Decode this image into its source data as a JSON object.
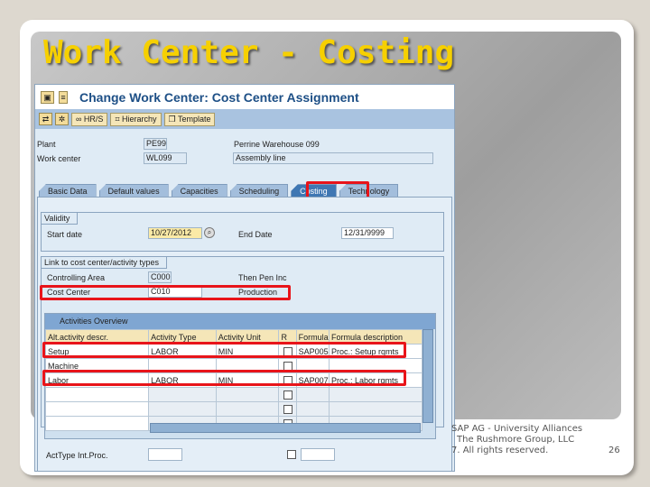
{
  "slide": {
    "title": "Work Center - Costing",
    "footer": [
      "SAP AG - University Alliances",
      "The Rushmore Group, LLC",
      "7. All rights reserved."
    ],
    "page": "26"
  },
  "sap": {
    "title": "Change Work Center: Cost Center Assignment",
    "toolbar": [
      "HR/S",
      "Hierarchy",
      "Template"
    ],
    "plant_label": "Plant",
    "plant": "PE99",
    "plant_desc": "Perrine Warehouse 099",
    "wc_label": "Work center",
    "wc": "WL099",
    "wc_desc": "Assembly line",
    "tabs": [
      "Basic Data",
      "Default values",
      "Capacities",
      "Scheduling",
      "Costing",
      "Technology"
    ],
    "validity": {
      "title": "Validity",
      "start_label": "Start date",
      "start": "10/27/2012",
      "end_label": "End Date",
      "end": "12/31/9999"
    },
    "link": {
      "title": "Link to cost center/activity types",
      "ca_label": "Controlling Area",
      "ca": "C000",
      "ca_desc": "Then Pen Inc",
      "cc_label": "Cost Center",
      "cc": "C010",
      "cc_desc": "Production"
    },
    "activities": {
      "title": "Activities Overview",
      "headers": [
        "Alt.activity descr.",
        "Activity Type",
        "Activity Unit",
        "R",
        "Formula",
        "Formula description"
      ],
      "rows": [
        [
          "Setup",
          "LABOR",
          "MIN",
          "",
          "SAP005",
          "Proc.: Setup rqmts"
        ],
        [
          "Machine",
          "",
          "",
          "",
          "",
          ""
        ],
        [
          "Labor",
          "LABOR",
          "MIN",
          "",
          "SAP007",
          "Proc.: Labor rqmts"
        ],
        [
          "",
          "",
          "",
          "",
          "",
          ""
        ],
        [
          "",
          "",
          "",
          "",
          "",
          ""
        ],
        [
          "",
          "",
          "",
          "",
          "",
          ""
        ]
      ]
    },
    "acttype_label": "ActType Int.Proc."
  }
}
